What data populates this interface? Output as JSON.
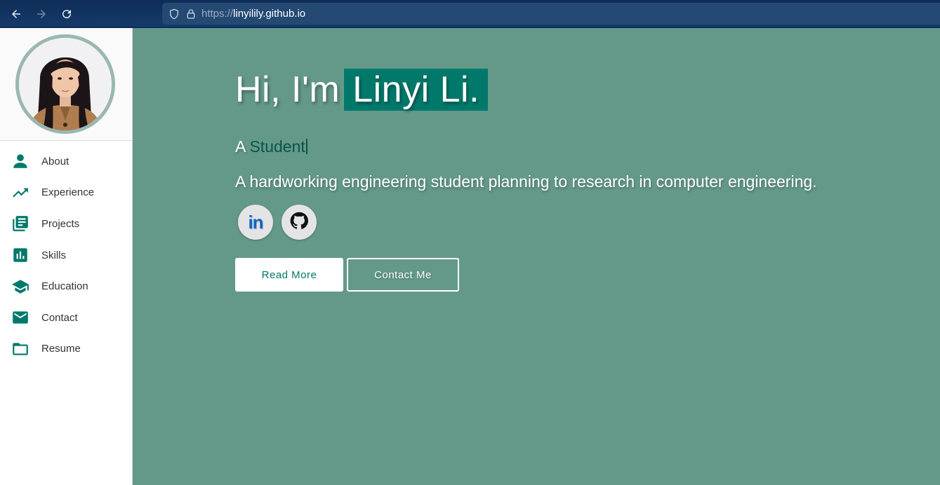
{
  "browser": {
    "url_scheme": "https://",
    "url_host": "linyilily.github.io",
    "icons": [
      "back-arrow-icon",
      "forward-arrow-icon",
      "reload-icon",
      "shield-icon",
      "lock-icon"
    ]
  },
  "sidebar": {
    "items": [
      {
        "label": "About",
        "icon": "person-icon"
      },
      {
        "label": "Experience",
        "icon": "trending-up-icon"
      },
      {
        "label": "Projects",
        "icon": "library-books-icon"
      },
      {
        "label": "Skills",
        "icon": "bar-chart-icon"
      },
      {
        "label": "Education",
        "icon": "graduation-cap-icon"
      },
      {
        "label": "Contact",
        "icon": "mail-icon"
      },
      {
        "label": "Resume",
        "icon": "folder-icon"
      }
    ]
  },
  "hero": {
    "greeting_prefix": "Hi, I'm",
    "name": "Linyi Li.",
    "subtitle_prefix": "A",
    "role": "Student",
    "tagline": "A hardworking engineering student planning to research in computer engineering.",
    "social": {
      "linkedin_text": "in"
    },
    "read_more_label": "Read More",
    "contact_label": "Contact Me"
  },
  "colors": {
    "accent": "#00796b",
    "hero_bg": "#64998a",
    "browser_bar": "#0e2d57",
    "linkedin": "#0a66c2"
  }
}
